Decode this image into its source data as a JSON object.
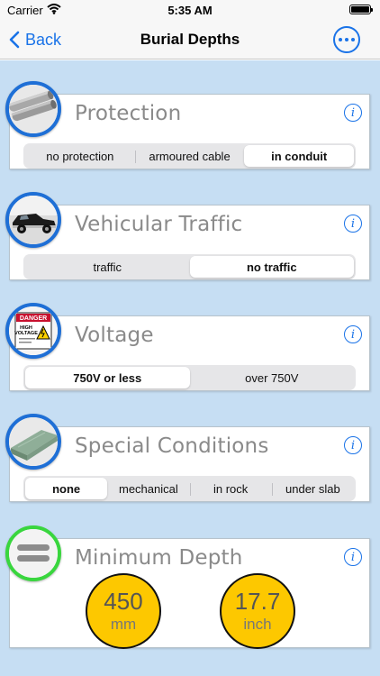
{
  "status": {
    "carrier": "Carrier",
    "time": "5:35 AM"
  },
  "nav": {
    "back_label": "Back",
    "title": "Burial Depths"
  },
  "colors": {
    "accent": "#1a73e8",
    "background": "#c6def3",
    "gauge": "#fdc800",
    "result_ring": "#39d63e"
  },
  "cards": {
    "protection": {
      "title": "Protection",
      "options": [
        "no protection",
        "armoured cable",
        "in conduit"
      ],
      "selected": "in conduit"
    },
    "traffic": {
      "title": "Vehicular Traffic",
      "options": [
        "traffic",
        "no traffic"
      ],
      "selected": "no traffic"
    },
    "voltage": {
      "title": "Voltage",
      "options": [
        "750V or less",
        "over 750V"
      ],
      "selected": "750V or less",
      "sign_heading": "DANGER",
      "sign_text_1": "HIGH",
      "sign_text_2": "VOLTAGE"
    },
    "special": {
      "title": "Special Conditions",
      "options": [
        "none",
        "mechanical",
        "in rock",
        "under slab"
      ],
      "selected": "none"
    },
    "result": {
      "title": "Minimum Depth",
      "metric_value": "450",
      "metric_unit": "mm",
      "imperial_value": "17.7",
      "imperial_unit": "inch"
    }
  },
  "icons": [
    "wifi-icon",
    "battery-icon",
    "chevron-left-icon",
    "more-icon",
    "info-icon",
    "conduit-pipes-icon",
    "car-icon",
    "danger-sign-icon",
    "slab-icon",
    "equals-icon"
  ]
}
